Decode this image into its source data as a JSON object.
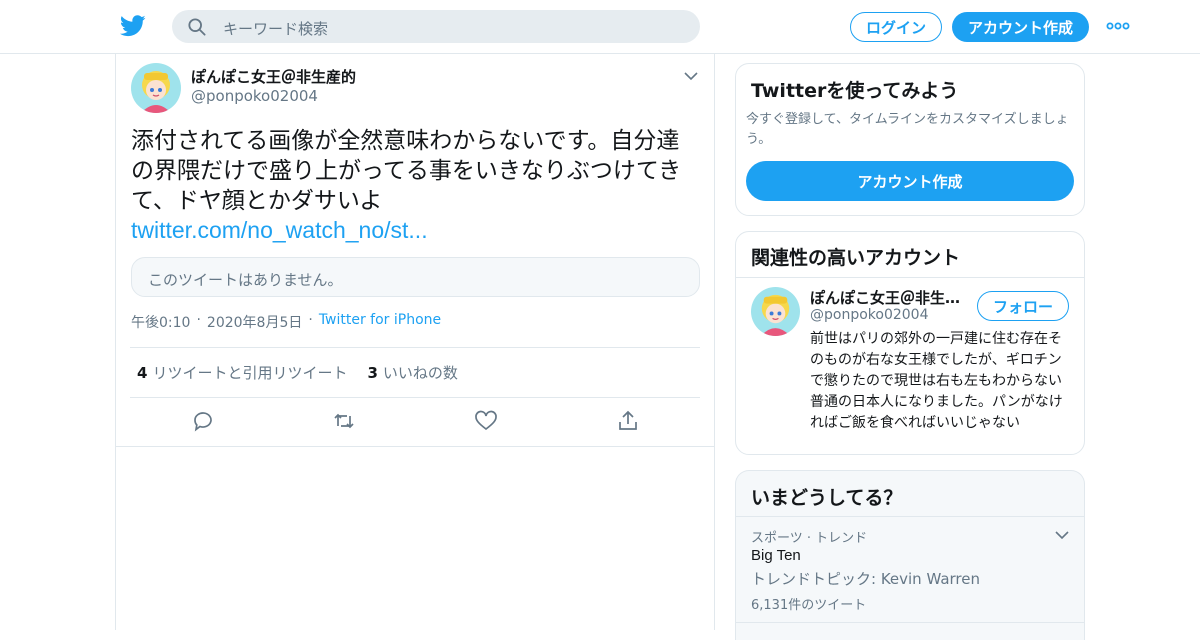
{
  "header": {
    "logo_icon": "twitter-bird-icon",
    "search_placeholder": "キーワード検索",
    "login_label": "ログイン",
    "signup_label": "アカウント作成",
    "more_icon": "more-dots-icon",
    "brand_color": "#1da1f2"
  },
  "tweet": {
    "author_name": "ぽんぽこ女王＠非生産的",
    "author_handle": "@ponpoko02004",
    "text": "添付されてる画像が全然意味わからないです。自分達の界隈だけで盛り上がってる事をいきなりぶつけてきて、ドヤ顔とかダサいよ",
    "link": "twitter.com/no_watch_no/st...",
    "quoted_unavailable": "このツイートはありません。",
    "time": "午後0:10",
    "date": "2020年8月5日",
    "source": "Twitter for iPhone",
    "retweets_count": "4",
    "retweets_label": "リツイートと引用リツイート",
    "likes_count": "3",
    "likes_label": "いいねの数"
  },
  "signup_card": {
    "title": "Twitterを使ってみよう",
    "subtitle": "今すぐ登録して、タイムラインをカスタマイズしましょう。",
    "button": "アカウント作成"
  },
  "related_card": {
    "title": "関連性の高いアカウント",
    "name": "ぽんぽこ女王＠非生産的",
    "handle": "@ponpoko02004",
    "follow_label": "フォロー",
    "bio": "前世はパリの郊外の一戸建に住む存在そのものが右な女王様でしたが、ギロチンで懲りたので現世は右も左もわからない普通の日本人になりました。パンがなければご飯を食べればいいじゃない"
  },
  "trends_card": {
    "title": "いまどうしてる？",
    "category": "スポーツ · トレンド",
    "name": "Big Ten",
    "topic": "トレンドトピック: Kevin Warren",
    "count": "6,131件のツイート"
  }
}
